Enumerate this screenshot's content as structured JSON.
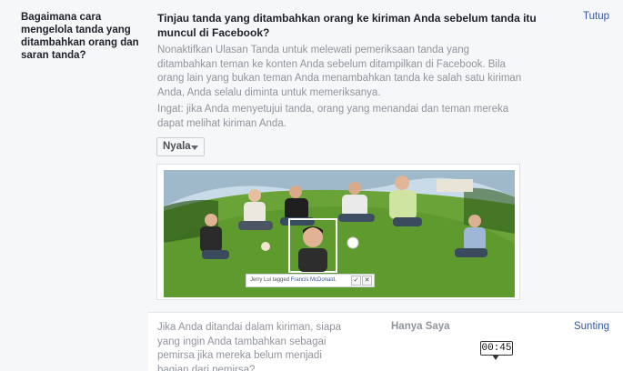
{
  "sidebar": {
    "question": "Bagaimana cara mengelola tanda yang ditambahkan orang dan saran tanda?"
  },
  "review": {
    "title": "Tinjau tanda yang ditambahkan orang ke kiriman Anda sebelum tanda itu muncul di Facebook?",
    "close_label": "Tutup",
    "paragraph1": "Nonaktifkan Ulasan Tanda untuk melewati pemeriksaan tanda yang ditambahkan teman ke konten Anda sebelum ditampilkan di Facebook. Bila orang lain yang bukan teman Anda menambahkan tanda ke salah satu kiriman Anda, Anda selalu diminta untuk memeriksanya.",
    "paragraph2": "Ingat: jika Anda menyetujui tanda, orang yang menandai dan teman mereka dapat melihat kiriman Anda.",
    "dropdown_value": "Nyala",
    "tag_bar": {
      "tagger": "Jerry Lui tagged",
      "tagged_name": "Francis McDonald.",
      "approve_icon": "check-icon",
      "reject_icon": "close-icon"
    }
  },
  "audience": {
    "question": "Jika Anda ditandai dalam kiriman, siapa yang ingin Anda tambahkan sebagai pemirsa jika mereka belum menjadi bagian dari pemirsa?",
    "value": "Hanya Saya",
    "edit_label": "Sunting"
  },
  "video_timer": "00:45",
  "colors": {
    "link": "#365899",
    "panel_bg": "#f6f7f9",
    "muted_text": "#90949c",
    "grass": "#5e9a2e",
    "sky": "#c9dbe8"
  }
}
